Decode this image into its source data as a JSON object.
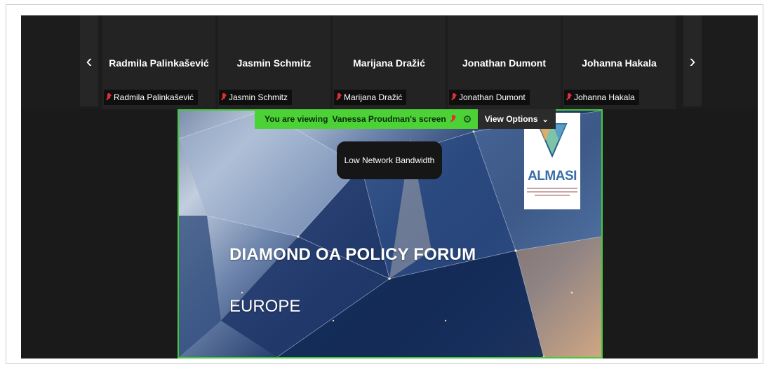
{
  "participants": [
    {
      "name": "Radmila Palinkašević",
      "label": "Radmila Palinkašević"
    },
    {
      "name": "Jasmin Schmitz",
      "label": "Jasmin Schmitz"
    },
    {
      "name": "Marijana Dražić",
      "label": "Marijana Dražić"
    },
    {
      "name": "Jonathan Dumont",
      "label": "Jonathan Dumont"
    },
    {
      "name": "Johanna Hakala",
      "label": "Johanna Hakala"
    }
  ],
  "nav": {
    "prev_icon": "chevron-left-icon",
    "next_icon": "chevron-right-icon"
  },
  "share_banner": {
    "viewing_prefix": "You are viewing",
    "viewing_subject": "Vanessa Proudman's screen",
    "view_options": "View Options"
  },
  "network_notice": "Low Network Bandwidth",
  "slide": {
    "logo_text": "ALMASI",
    "title": "DIAMOND OA POLICY FORUM",
    "subtitle": "EUROPE"
  },
  "colors": {
    "share_border": "#45c93a",
    "banner_green": "#4cd137",
    "muted_mic": "#e03030",
    "logo_blue": "#3a6ea8"
  }
}
